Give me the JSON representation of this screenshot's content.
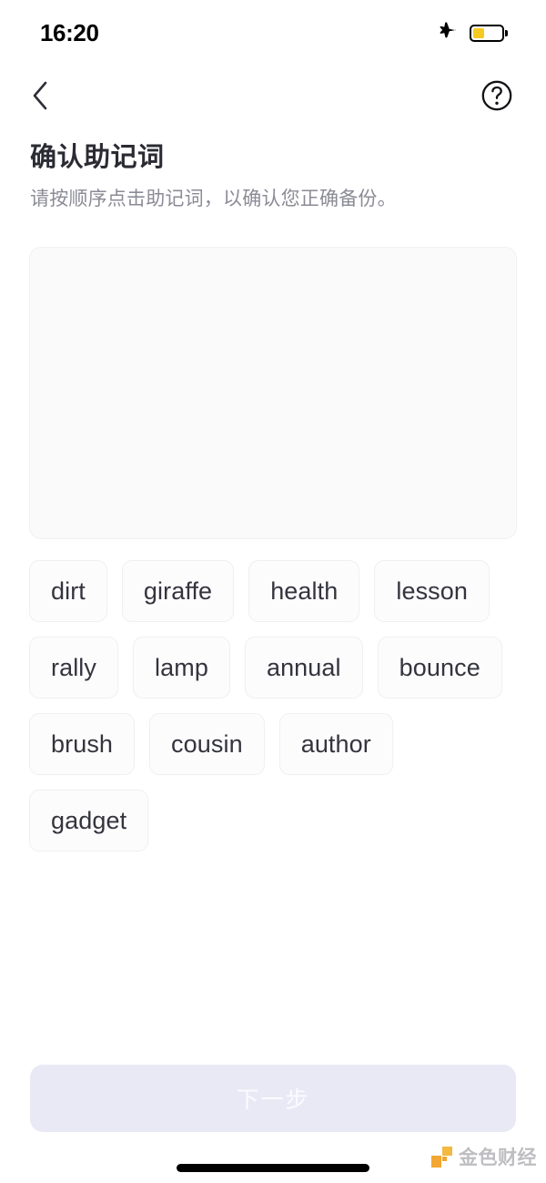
{
  "status_bar": {
    "time": "16:20",
    "airplane_icon": "airplane-icon",
    "battery_icon": "battery-icon",
    "battery_level_percent": 42,
    "battery_color": "#f6ca20"
  },
  "nav_bar": {
    "back_icon": "chevron-left-icon",
    "help_icon": "question-circle-icon"
  },
  "header": {
    "title": "确认助记词",
    "subtitle": "请按顺序点击助记词，以确认您正确备份。"
  },
  "selected_area": {
    "name": "selected-words-drop-zone",
    "words": [],
    "background_color": "#fafafb",
    "border_color": "#f1f1f3"
  },
  "word_bank": {
    "words": [
      "dirt",
      "giraffe",
      "health",
      "lesson",
      "rally",
      "lamp",
      "annual",
      "bounce",
      "brush",
      "cousin",
      "author",
      "gadget"
    ]
  },
  "footer": {
    "next_label": "下一步",
    "next_enabled": false,
    "next_bg_color": "#e9e9f6",
    "next_text_color": "#fbfbfe"
  },
  "watermark": {
    "text": "金色财经",
    "accent_color": "#f0a020"
  }
}
